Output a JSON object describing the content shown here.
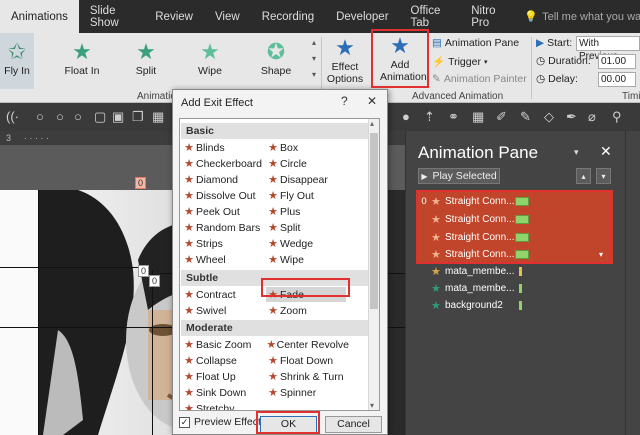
{
  "tabs": [
    "Animations",
    "Slide Show",
    "Review",
    "View",
    "Recording",
    "Developer",
    "Office Tab",
    "Nitro Pro"
  ],
  "tell_me": "Tell me what you want to do",
  "ribbon": {
    "effects": [
      "Fly In",
      "Float In",
      "Split",
      "Wipe",
      "Shape"
    ],
    "effect_options": "Effect Options",
    "add_animation": "Add Animation",
    "animation_pane": "Animation Pane",
    "trigger": "Trigger",
    "animation_painter": "Animation Painter",
    "start_label": "Start:",
    "start_value": "With Previous",
    "duration_label": "Duration:",
    "duration_value": "01.00",
    "delay_label": "Delay:",
    "delay_value": "00.00",
    "group_animation": "Animation",
    "group_advanced": "Advanced Animation",
    "group_timing": "Timi"
  },
  "slide": {
    "tag_top": "0",
    "tag_mid": "0",
    "tag_mid2": "0"
  },
  "dialog": {
    "title": "Add Exit Effect",
    "help": "?",
    "close": "✕",
    "categories": {
      "basic": "Basic",
      "subtle": "Subtle",
      "moderate": "Moderate"
    },
    "basic_left": [
      "Blinds",
      "Checkerboard",
      "Diamond",
      "Dissolve Out",
      "Peek Out",
      "Random Bars",
      "Strips",
      "Wheel"
    ],
    "basic_right": [
      "Box",
      "Circle",
      "Disappear",
      "Fly Out",
      "Plus",
      "Split",
      "Wedge",
      "Wipe"
    ],
    "subtle_left": [
      "Contract",
      "Swivel"
    ],
    "subtle_right": [
      "Fade",
      "Zoom"
    ],
    "moderate_left": [
      "Basic Zoom",
      "Collapse",
      "Float Up",
      "Sink Down",
      "Stretchy"
    ],
    "moderate_right": [
      "Center Revolve",
      "Float Down",
      "Shrink & Turn",
      "Spinner"
    ],
    "preview": "Preview Effect",
    "ok": "OK",
    "cancel": "Cancel"
  },
  "pane": {
    "title": "Animation Pane",
    "play": "Play Selected",
    "items": [
      {
        "idx": "0",
        "name": "Straight Conn..."
      },
      {
        "idx": "",
        "name": "Straight Conn..."
      },
      {
        "idx": "",
        "name": "Straight Conn..."
      },
      {
        "idx": "",
        "name": "Straight Conn..."
      },
      {
        "idx": "",
        "name": "mata_membe..."
      },
      {
        "idx": "",
        "name": "mata_membe..."
      },
      {
        "idx": "",
        "name": "background2"
      }
    ]
  },
  "colors": {
    "highlight_red": "#e03030",
    "pane_selected": "#c0452a",
    "star_exit": "#b5492a",
    "star_entrance": "#2f9c7f"
  }
}
